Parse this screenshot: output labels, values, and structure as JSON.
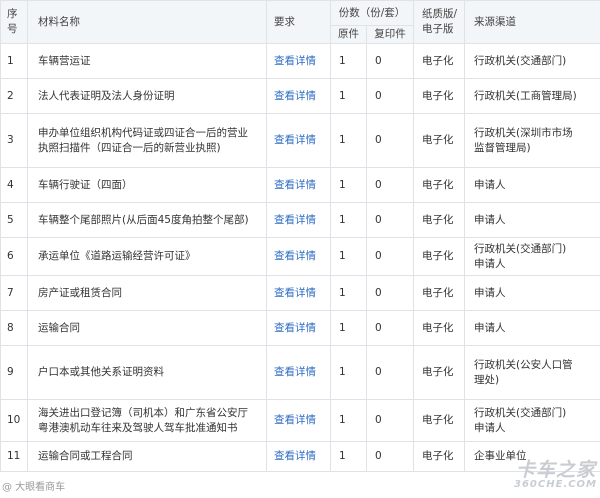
{
  "table": {
    "headers": {
      "index_line1": "序",
      "index_line2": "号",
      "name": "材料名称",
      "requirement": "要求",
      "count_group": "份数（份/套）",
      "original": "原件",
      "copy": "复印件",
      "format_line1": "纸质版/",
      "format_line2": "电子版",
      "source": "来源渠道"
    },
    "rows": [
      {
        "index": "1",
        "name_lines": [
          "车辆营运证"
        ],
        "link": "查看详情",
        "original": "1",
        "copy": "0",
        "format": "电子化",
        "source_lines": [
          "行政机关(交通部门)"
        ]
      },
      {
        "index": "2",
        "name_lines": [
          "法人代表证明及法人身份证明"
        ],
        "link": "查看详情",
        "original": "1",
        "copy": "0",
        "format": "电子化",
        "source_lines": [
          "行政机关(工商管理局)"
        ]
      },
      {
        "index": "3",
        "name_lines": [
          "申办单位组织机构代码证或四证合一后的营业",
          "执照扫描件（四证合一后的新营业执照)"
        ],
        "link": "查看详情",
        "original": "1",
        "copy": "0",
        "format": "电子化",
        "source_lines": [
          "行政机关(深圳市市场",
          "监督管理局)"
        ]
      },
      {
        "index": "4",
        "name_lines": [
          "车辆行驶证（四面）"
        ],
        "link": "查看详情",
        "original": "1",
        "copy": "0",
        "format": "电子化",
        "source_lines": [
          "申请人"
        ]
      },
      {
        "index": "5",
        "name_lines": [
          "车辆整个尾部照片(从后面45度角拍整个尾部)"
        ],
        "link": "查看详情",
        "original": "1",
        "copy": "0",
        "format": "电子化",
        "source_lines": [
          "申请人"
        ]
      },
      {
        "index": "6",
        "name_lines": [
          "承运单位《道路运输经营许可证》"
        ],
        "link": "查看详情",
        "original": "1",
        "copy": "0",
        "format": "电子化",
        "source_lines": [
          "行政机关(交通部门)",
          "申请人"
        ]
      },
      {
        "index": "7",
        "name_lines": [
          "房产证或租赁合同"
        ],
        "link": "查看详情",
        "original": "1",
        "copy": "0",
        "format": "电子化",
        "source_lines": [
          "申请人"
        ]
      },
      {
        "index": "8",
        "name_lines": [
          "运输合同"
        ],
        "link": "查看详情",
        "original": "1",
        "copy": "0",
        "format": "电子化",
        "source_lines": [
          "申请人"
        ]
      },
      {
        "index": "9",
        "name_lines": [
          "户口本或其他关系证明资料"
        ],
        "link": "查看详情",
        "original": "1",
        "copy": "0",
        "format": "电子化",
        "source_lines": [
          "行政机关(公安人口管",
          "理处)"
        ]
      },
      {
        "index": "10",
        "name_lines": [
          "海关进出口登记簿（司机本）和广东省公安厅",
          "粤港澳机动车往来及驾驶人驾车批准通知书"
        ],
        "link": "查看详情",
        "original": "1",
        "copy": "0",
        "format": "电子化",
        "source_lines": [
          "行政机关(交通部门)",
          "申请人"
        ]
      },
      {
        "index": "11",
        "name_lines": [
          "运输合同或工程合同"
        ],
        "link": "查看详情",
        "original": "1",
        "copy": "0",
        "format": "电子化",
        "source_lines": [
          "企事业单位"
        ]
      }
    ]
  },
  "watermarks": {
    "left_text": "@ 大眼看商车",
    "logo_big": "卡车之家",
    "logo_small": "360CHE.COM"
  }
}
